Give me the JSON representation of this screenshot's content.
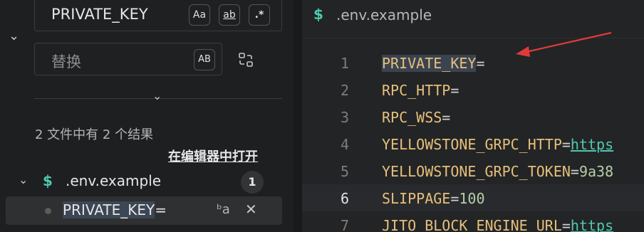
{
  "search": {
    "find_value": "PRIVATE_KEY",
    "replace_placeholder": "替换",
    "opt_case": "Aa",
    "opt_word": "ab",
    "opt_regex": ".*",
    "opt_preserve_case": "AB"
  },
  "results": {
    "summary": "2 文件中有 2 个结果",
    "open_in_editor": "在编辑器中打开",
    "file": {
      "icon": "$",
      "name": ".env.example",
      "count": "1"
    },
    "match": {
      "highlight": "PRIVATE_KEY",
      "suffix": "="
    }
  },
  "editor": {
    "tab": {
      "icon": "$",
      "name": ".env.example"
    },
    "active_line": "6",
    "lines": [
      {
        "num": "1",
        "key": "PRIVATE_KEY",
        "eq": "=",
        "val": ""
      },
      {
        "num": "2",
        "key": "RPC_HTTP",
        "eq": "=",
        "val": ""
      },
      {
        "num": "3",
        "key": "RPC_WSS",
        "eq": "=",
        "val": ""
      },
      {
        "num": "4",
        "key": "YELLOWSTONE_GRPC_HTTP",
        "eq": "=",
        "val": "https"
      },
      {
        "num": "5",
        "key": "YELLOWSTONE_GRPC_TOKEN",
        "eq": "=",
        "val": "9a38"
      },
      {
        "num": "6",
        "key": "SLIPPAGE",
        "eq": "=",
        "val": "100"
      },
      {
        "num": "7",
        "key": "JITO_BLOCK_ENGINE_URL",
        "eq": "=",
        "val": "https"
      }
    ]
  },
  "colors": {
    "accent_teal": "#4ec9b0",
    "key_yellow": "#e5c07b",
    "annotation_red": "#e03a3a"
  }
}
